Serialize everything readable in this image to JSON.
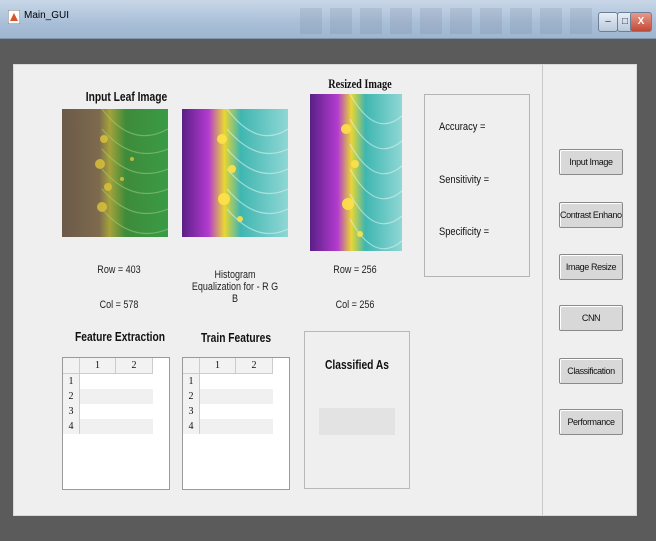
{
  "window": {
    "title": "Main_GUI",
    "minimize": "–",
    "maximize": "□",
    "close": "X"
  },
  "input": {
    "heading": "Input Leaf Image",
    "row": "Row = 403",
    "col": "Col = 578"
  },
  "hist": {
    "caption": "Histogram Equalization for - R G B"
  },
  "resized": {
    "heading": "Resized Image",
    "row": "Row = 256",
    "col": "Col = 256"
  },
  "metrics": {
    "accuracy": "Accuracy =",
    "sensitivity": "Sensitivity =",
    "specificity": "Specificity ="
  },
  "feature": {
    "heading": "Feature Extraction",
    "cols": [
      "1",
      "2"
    ],
    "rows": [
      "1",
      "2",
      "3",
      "4"
    ]
  },
  "train": {
    "heading": "Train Features",
    "cols": [
      "1",
      "2"
    ],
    "rows": [
      "1",
      "2",
      "3",
      "4"
    ]
  },
  "classified": {
    "heading": "Classified As",
    "result": ""
  },
  "buttons": [
    "Input Image",
    "Contrast Enhancement",
    "Image Resize",
    "CNN",
    "Classification",
    "Performance"
  ]
}
